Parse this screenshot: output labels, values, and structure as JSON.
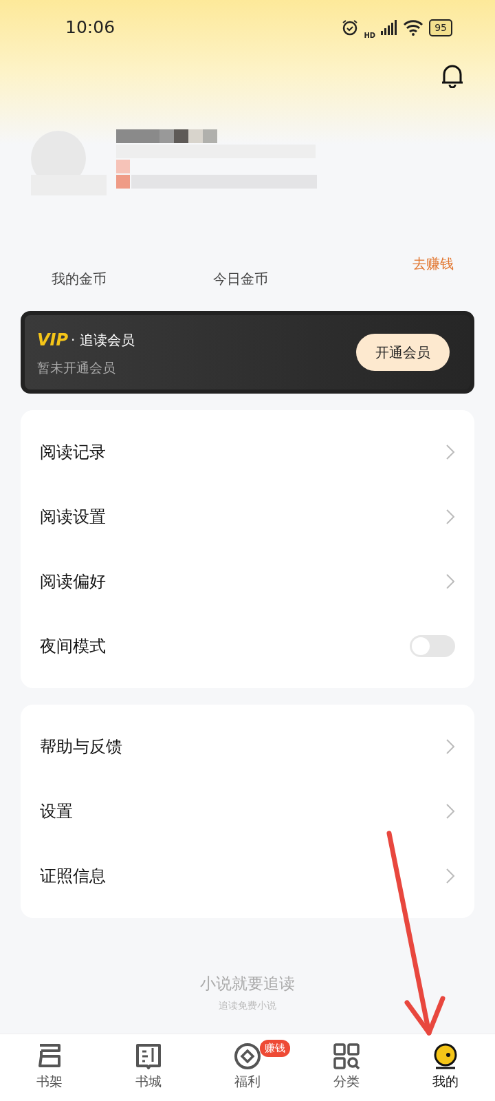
{
  "status_bar": {
    "time": "10:06",
    "network": "HD",
    "battery": "95"
  },
  "profile": {
    "kind": "picture"
  },
  "coins": [
    {
      "label": "我的金币"
    },
    {
      "label": "今日金币"
    }
  ],
  "earn_link": "去赚钱",
  "vip": {
    "logo": "VIP",
    "title": "· 追读会员",
    "subtitle": "暂未开通会员",
    "button": "开通会员"
  },
  "menu_groups": [
    [
      {
        "kind": "link",
        "label": "阅读记录"
      },
      {
        "kind": "link",
        "label": "阅读设置"
      },
      {
        "kind": "link",
        "label": "阅读偏好"
      },
      {
        "kind": "toggle",
        "label": "夜间模式",
        "on": false
      }
    ],
    [
      {
        "kind": "link",
        "label": "帮助与反馈"
      },
      {
        "kind": "link",
        "label": "设置"
      },
      {
        "kind": "link",
        "label": "证照信息"
      }
    ]
  ],
  "footer": {
    "slogan": "小说就要追读",
    "tagline": "追读免费小说"
  },
  "tabs": [
    {
      "label": "书架",
      "kind": "shelf",
      "selected": false
    },
    {
      "label": "书城",
      "kind": "book",
      "selected": false
    },
    {
      "label": "福利",
      "kind": "coin",
      "selected": false,
      "badge": "赚钱"
    },
    {
      "label": "分类",
      "kind": "grid",
      "selected": false
    },
    {
      "label": "我的",
      "kind": "me",
      "selected": true
    }
  ],
  "annotation": {
    "kind": "arrow"
  }
}
